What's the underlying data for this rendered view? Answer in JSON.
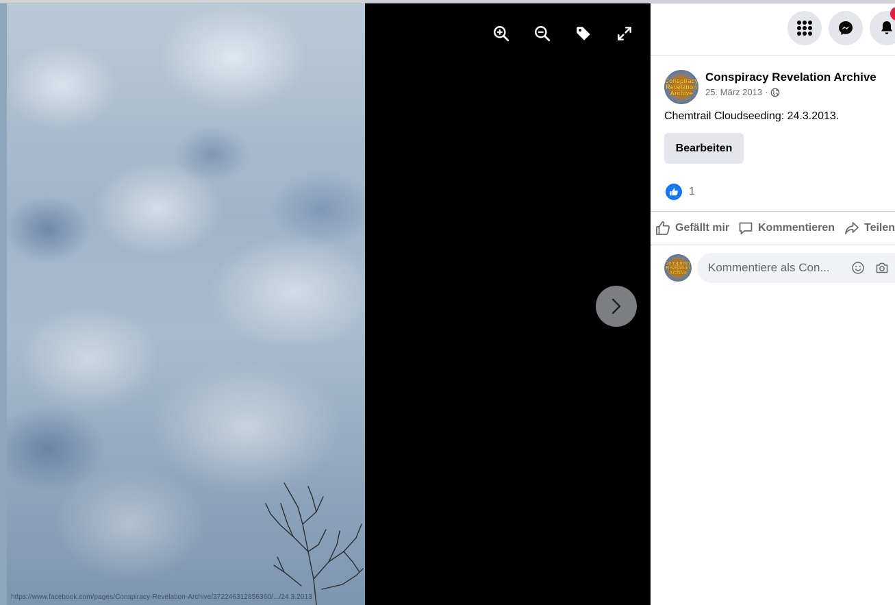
{
  "viewer": {
    "photo_url_text": "https://www.facebook.com/pages/Conspiracy-Revelation-Archive/372246312856360/.../24.3.2013",
    "tools": [
      {
        "icon": "zoom-in-icon"
      },
      {
        "icon": "zoom-out-icon"
      },
      {
        "icon": "tag-icon"
      },
      {
        "icon": "fullscreen-icon"
      }
    ],
    "next_icon": "chevron-right-icon"
  },
  "header": {
    "buttons": [
      {
        "icon": "menu-grid-icon"
      },
      {
        "icon": "messenger-icon"
      },
      {
        "icon": "notifications-bell-icon"
      }
    ],
    "badge_color": "#e41e3f"
  },
  "post": {
    "page_name": "Conspiracy Revelation Archive",
    "avatar_text": [
      "Conspiracy",
      "Revelation",
      "Archive"
    ],
    "date": "25. März 2013",
    "date_separator": "·",
    "privacy_icon": "globe-icon",
    "text": "Chemtrail Cloudseeding: 24.3.2013.",
    "edit_label": "Bearbeiten",
    "reaction_count": "1",
    "reaction_icon": "like-reaction-icon",
    "actions": {
      "like": "Gefällt mir",
      "comment": "Kommentieren",
      "share": "Teilen"
    },
    "comment_placeholder": "Kommentiere als Conspiracy Revelation Archive",
    "comment_placeholder_visible": "Kommentiere als Con..."
  },
  "colors": {
    "accent": "#1877f2",
    "button_bg": "#e4e6eb",
    "secondary_text": "#65676b",
    "viewer_bg": "#000000"
  }
}
